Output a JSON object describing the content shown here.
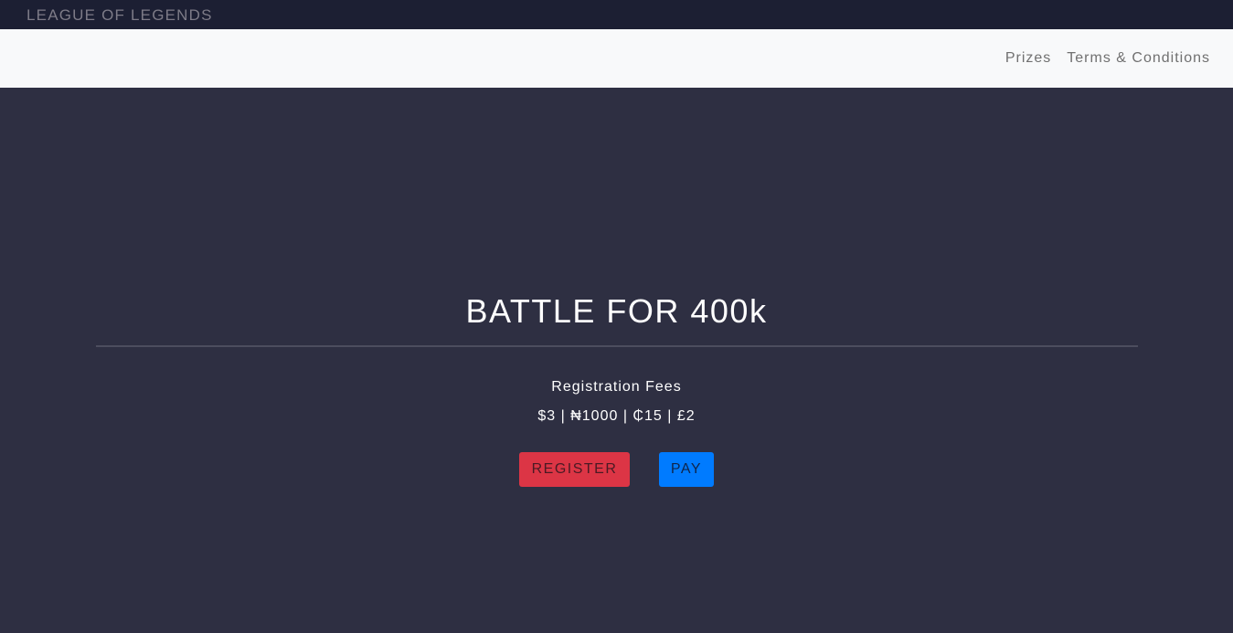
{
  "topbar": {
    "brand": "LEAGUE OF LEGENDS"
  },
  "navbar": {
    "links": [
      "Prizes",
      "Terms & Conditions"
    ]
  },
  "hero": {
    "title": "BATTLE FOR 400k",
    "fees_label": "Registration Fees",
    "fees_values": "$3 | ₦1000 | ₵15 | £2",
    "register_label": "REGISTER",
    "pay_label": "PAY"
  },
  "colors": {
    "topbar_bg": "#1c1f33",
    "navbar_bg": "#f8f9fa",
    "hero_bg": "#2e2f42",
    "register_btn": "#dc3545",
    "pay_btn": "#007bff"
  }
}
